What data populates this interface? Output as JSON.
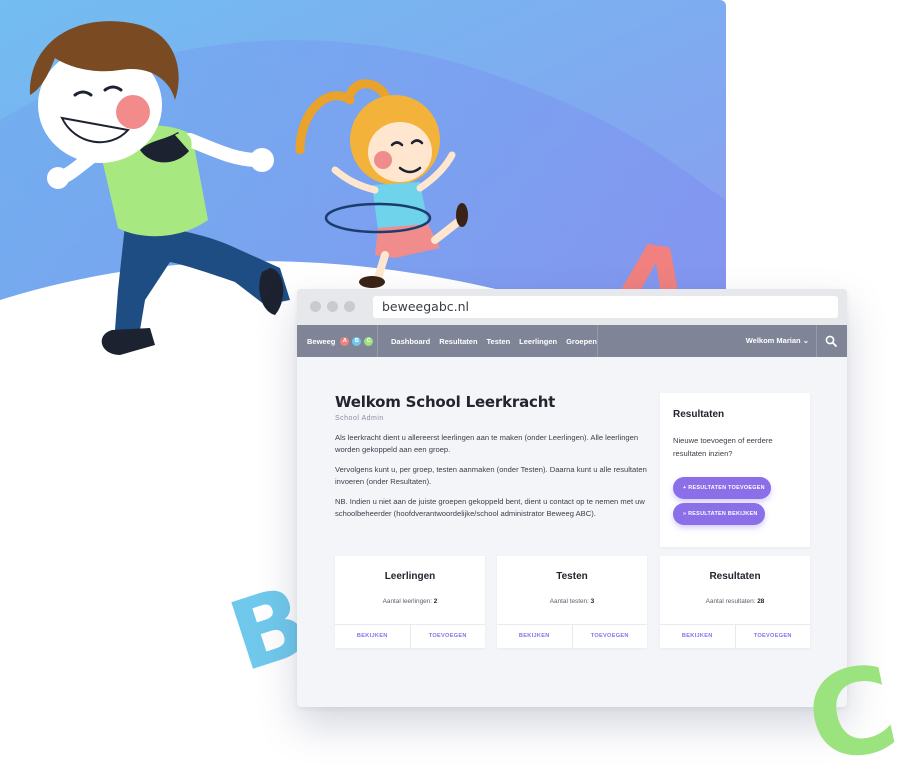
{
  "browser": {
    "url": "beweegabc.nl"
  },
  "nav": {
    "brand": "Beweeg",
    "brand_badges": [
      "A",
      "B",
      "C"
    ],
    "items": [
      "Dashboard",
      "Resultaten",
      "Testen",
      "Leerlingen",
      "Groepen"
    ],
    "welcome": "Welkom Marian"
  },
  "intro": {
    "title": "Welkom School Leerkracht",
    "role": "School Admin",
    "paragraphs": [
      "Als leerkracht dient u allereerst leerlingen aan te maken (onder Leerlingen). Alle leerlingen worden gekoppeld aan een groep.",
      "Vervolgens kunt u, per groep, testen aanmaken (onder Testen). Daarna kunt u alle resultaten invoeren (onder Resultaten).",
      "NB. Indien u niet aan de juiste groepen gekoppeld bent, dient u contact op te nemen met uw schoolbeheerder (hoofdverantwoordelijke/school administrator Beweeg ABC)."
    ]
  },
  "results_card": {
    "title": "Resultaten",
    "text": "Nieuwe toevoegen of eerdere resultaten inzien?",
    "add_button": "+ RESULTATEN TOEVOEGEN",
    "view_button": "» RESULTATEN BEKIJKEN"
  },
  "cards": [
    {
      "title": "Leerlingen",
      "stat_label": "Aantal leerlingen:",
      "stat_value": "2",
      "view": "BEKIJKEN",
      "add": "TOEVOEGEN"
    },
    {
      "title": "Testen",
      "stat_label": "Aantal testen:",
      "stat_value": "3",
      "view": "BEKIJKEN",
      "add": "TOEVOEGEN"
    },
    {
      "title": "Resultaten",
      "stat_label": "Aantal resultaten:",
      "stat_value": "28",
      "view": "BEKIJKEN",
      "add": "TOEVOEGEN"
    }
  ],
  "letters": {
    "a": "A",
    "b": "B",
    "c": "C"
  },
  "colors": {
    "hero_top": "#6fb3f0",
    "hero_bottom": "#8c9cf0",
    "nav_bg": "#7f8497",
    "accent_purple": "#8b6fe8",
    "letter_a": "#f0817f",
    "letter_b": "#70c9ec",
    "letter_c": "#9ae37f"
  }
}
